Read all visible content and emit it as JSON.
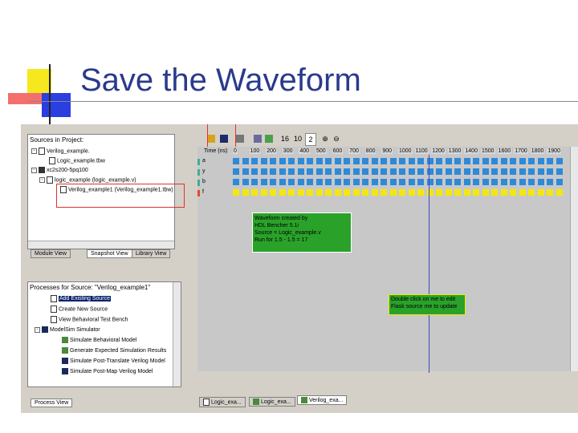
{
  "slide": {
    "title": "Save the Waveform"
  },
  "sources": {
    "header": "Sources in Project:",
    "items": [
      "Verilog_example.",
      "Logic_example.tbw",
      "xc2s200-5pq100",
      "logic_example (logic_example.v)",
      "Verilog_example1 (Verilog_example1.tbw)"
    ],
    "tabs": [
      "Module View",
      "Snapshot View",
      "Library View"
    ]
  },
  "processes": {
    "header": "Processes for Source: \"Verilog_example1\"",
    "items": [
      "Add Existing Source",
      "Create New Source",
      "View Behavioral Test Bench",
      "ModelSim Simulator",
      "Simulate Behavioral Model",
      "Generate Expected Simulation Results",
      "Simulate Post-Translate Verilog Model",
      "Simulate Post-Map Verilog Model"
    ],
    "tab": "Process View"
  },
  "toolbar": {
    "zoom16": "16",
    "zoom10": "10",
    "zoom2": "2"
  },
  "waveform": {
    "time_label": "Time (ns)",
    "ticks": [
      "0",
      "100",
      "200",
      "300",
      "400",
      "500",
      "600",
      "700",
      "800",
      "900",
      "1000",
      "1100",
      "1200",
      "1300",
      "1400",
      "1500",
      "1600",
      "1700",
      "1800",
      "1900"
    ],
    "signals": [
      "a",
      "y",
      "b",
      "f"
    ],
    "note1": [
      "Waveform created by",
      "HDL Bencher 5.1i",
      "Source = Logic_example.v",
      "Run for 1.5 - 1.5 = 17"
    ],
    "note2": [
      "Double click on me to edit",
      "Flask source me to update"
    ]
  },
  "doc_tabs": [
    "Logic_exa...",
    "Logic_exa...",
    "Verilog_exa..."
  ],
  "colors": {
    "title": "#2a3a8c",
    "wave_blue": "#2e8ad8",
    "wave_yellow": "#f4e80a",
    "note_green": "#2aa22a"
  }
}
